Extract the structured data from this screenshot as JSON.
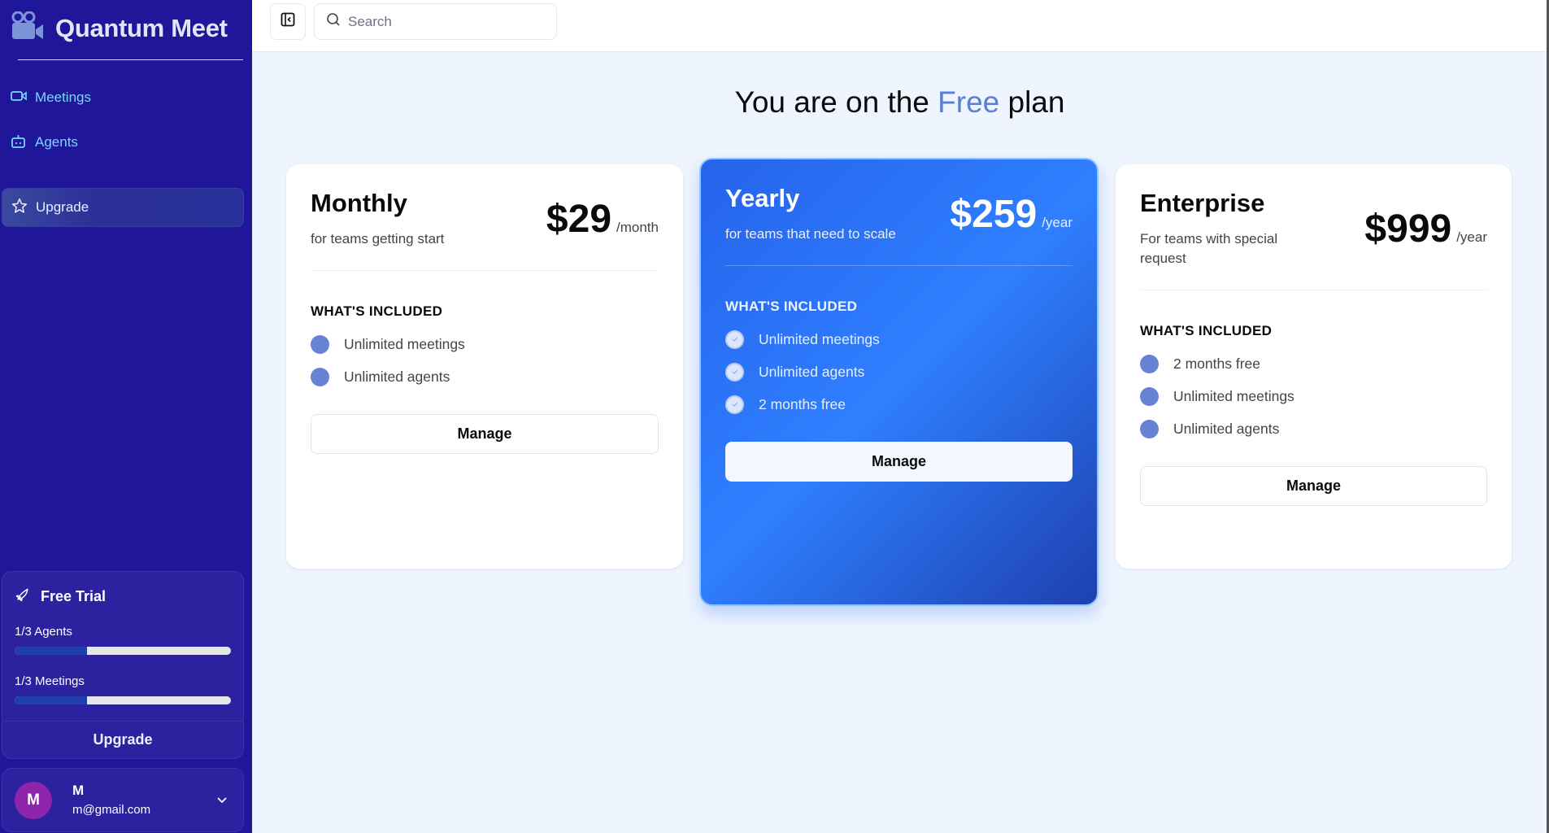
{
  "app": {
    "name": "Quantum Meet"
  },
  "sidebar": {
    "items": [
      {
        "label": "Meetings",
        "icon": "video-icon"
      },
      {
        "label": "Agents",
        "icon": "bot-icon"
      },
      {
        "label": "Upgrade",
        "icon": "star-icon",
        "active": true
      }
    ]
  },
  "trial": {
    "title": "Free Trial",
    "agents_label": "1/3 Agents",
    "agents_progress": 0.333,
    "meetings_label": "1/3 Meetings",
    "meetings_progress": 0.333,
    "upgrade_label": "Upgrade"
  },
  "user": {
    "initial": "M",
    "name": "M",
    "email": "m@gmail.com"
  },
  "header": {
    "search_placeholder": "Search"
  },
  "page": {
    "title_prefix": "You are on the ",
    "title_plan": "Free",
    "title_suffix": " plan",
    "accent": "#5b7fd6"
  },
  "plans": [
    {
      "name": "Monthly",
      "description": "for teams getting start",
      "price": "$29",
      "unit": "/month",
      "included_label": "WHAT'S INCLUDED",
      "features": [
        "Unlimited meetings",
        "Unlimited agents"
      ],
      "button": "Manage"
    },
    {
      "name": "Yearly",
      "description": "for teams that need to scale",
      "price": "$259",
      "unit": "/year",
      "included_label": "WHAT'S INCLUDED",
      "features": [
        "Unlimited meetings",
        "Unlimited agents",
        "2 months free"
      ],
      "button": "Manage",
      "featured": true
    },
    {
      "name": "Enterprise",
      "description": "For teams with special request",
      "price": "$999",
      "unit": "/year",
      "included_label": "WHAT'S INCLUDED",
      "features": [
        "2 months free",
        "Unlimited meetings",
        "Unlimited agents"
      ],
      "button": "Manage"
    }
  ]
}
